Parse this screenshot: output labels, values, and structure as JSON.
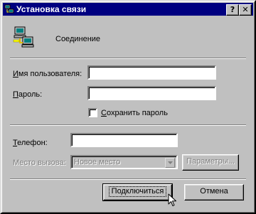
{
  "window": {
    "title": "Установка связи",
    "help_btn": "?",
    "close_btn": "✕"
  },
  "connection": {
    "name": "Соединение"
  },
  "form": {
    "username_label_first": "И",
    "username_label_rest": "мя пользователя:",
    "username_value": "",
    "password_label_first": "П",
    "password_label_rest": "ароль:",
    "password_value": "",
    "save_password_first": "С",
    "save_password_rest": "охранить пароль",
    "phone_label_first": "Т",
    "phone_label_rest": "елефон:",
    "phone_value": "",
    "location_label": "Место вызова:",
    "location_value": "Новое место",
    "params_label": "Параметры..."
  },
  "buttons": {
    "connect": "Подключиться",
    "cancel": "Отмена"
  }
}
